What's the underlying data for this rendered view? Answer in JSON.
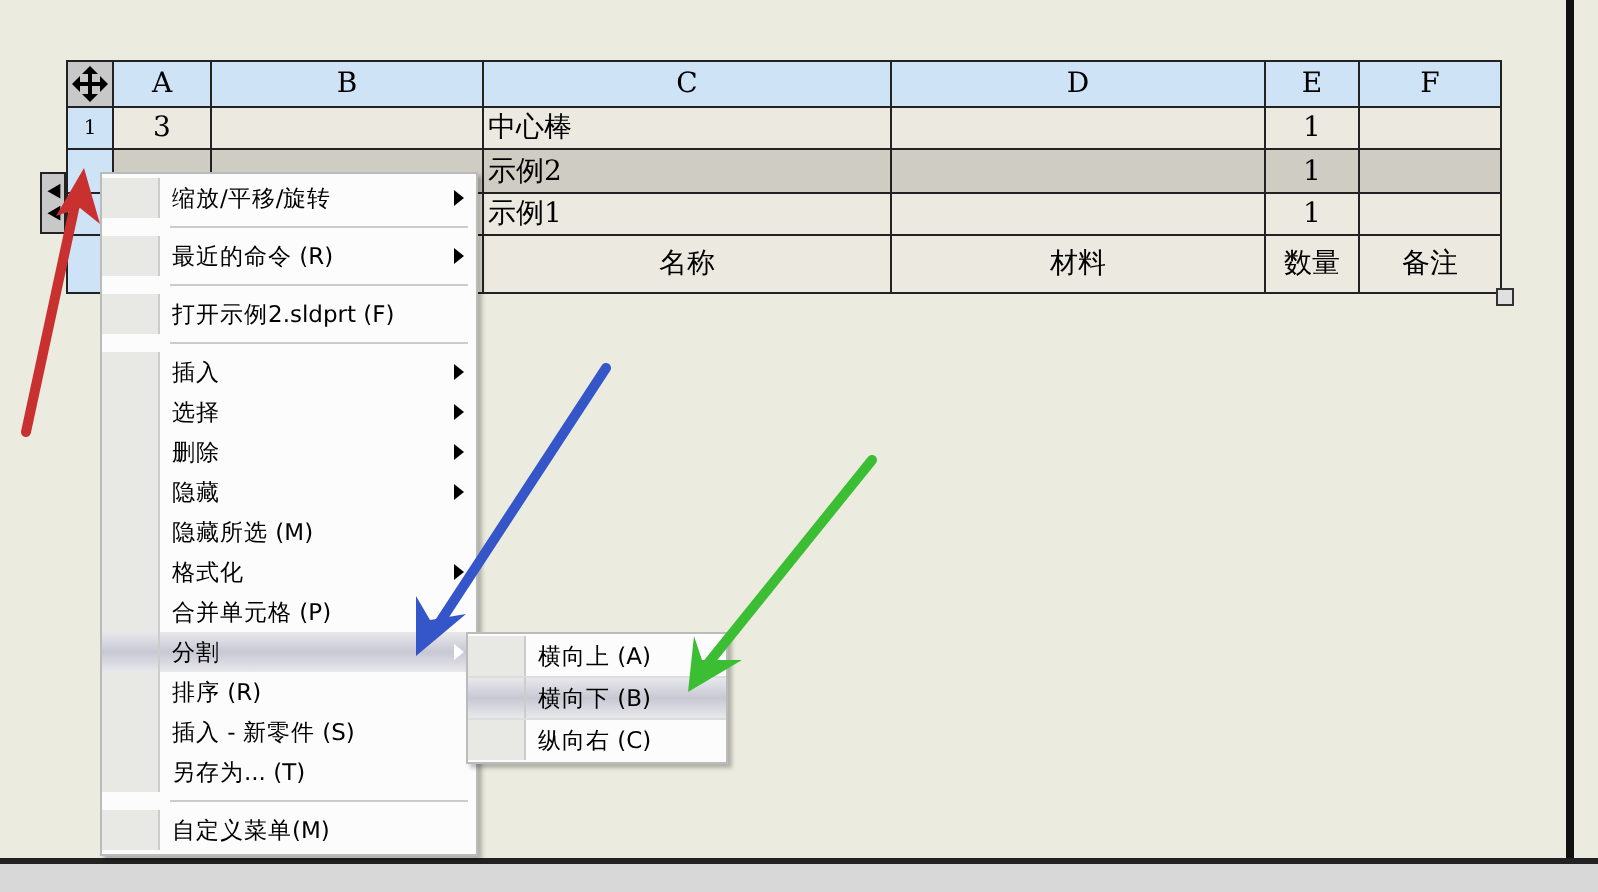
{
  "table": {
    "columns": [
      "A",
      "B",
      "C",
      "D",
      "E",
      "F"
    ],
    "rows": [
      {
        "header": "1",
        "selected": false,
        "cells": [
          "3",
          null,
          "中心棒",
          null,
          "1",
          null
        ]
      },
      {
        "selected": true,
        "cells": [
          null,
          null,
          "示例2",
          null,
          "1",
          null
        ]
      },
      {
        "selected": false,
        "cells": [
          null,
          null,
          "示例1",
          null,
          "1",
          null
        ]
      },
      {
        "selected": false,
        "kind": "footer",
        "cells": [
          null,
          null,
          "名称",
          "材料",
          "数量",
          "备注"
        ]
      }
    ]
  },
  "context_menu": {
    "items": [
      {
        "kind": "item",
        "label": "缩放/平移/旋转",
        "submenu": true,
        "selected": false
      },
      {
        "kind": "separator"
      },
      {
        "kind": "item",
        "label": "最近的命令 (R)",
        "submenu": true,
        "selected": false
      },
      {
        "kind": "separator"
      },
      {
        "kind": "item",
        "label": "打开示例2.sldprt (F)",
        "submenu": false,
        "selected": false
      },
      {
        "kind": "separator"
      },
      {
        "kind": "item",
        "label": "插入",
        "submenu": true,
        "selected": false
      },
      {
        "kind": "item",
        "label": "选择",
        "submenu": true,
        "selected": false
      },
      {
        "kind": "item",
        "label": "删除",
        "submenu": true,
        "selected": false
      },
      {
        "kind": "item",
        "label": "隐藏",
        "submenu": true,
        "selected": false
      },
      {
        "kind": "item",
        "label": "隐藏所选 (M)",
        "submenu": false,
        "selected": false
      },
      {
        "kind": "item",
        "label": "格式化",
        "submenu": true,
        "selected": false
      },
      {
        "kind": "item",
        "label": "合并单元格 (P)",
        "submenu": false,
        "selected": false
      },
      {
        "kind": "item",
        "label": "分割",
        "submenu": true,
        "selected": true
      },
      {
        "kind": "item",
        "label": "排序 (R)",
        "submenu": false,
        "selected": false
      },
      {
        "kind": "item",
        "label": "插入 - 新零件 (S)",
        "submenu": false,
        "selected": false
      },
      {
        "kind": "item",
        "label": "另存为... (T)",
        "submenu": false,
        "selected": false
      },
      {
        "kind": "separator"
      },
      {
        "kind": "item",
        "label": "自定义菜单(M)",
        "submenu": false,
        "selected": false
      }
    ]
  },
  "submenu": {
    "items": [
      {
        "label": "横向上 (A)",
        "selected": false
      },
      {
        "label": "横向下 (B)",
        "selected": true
      },
      {
        "label": "纵向右 (C)",
        "selected": false
      }
    ]
  }
}
